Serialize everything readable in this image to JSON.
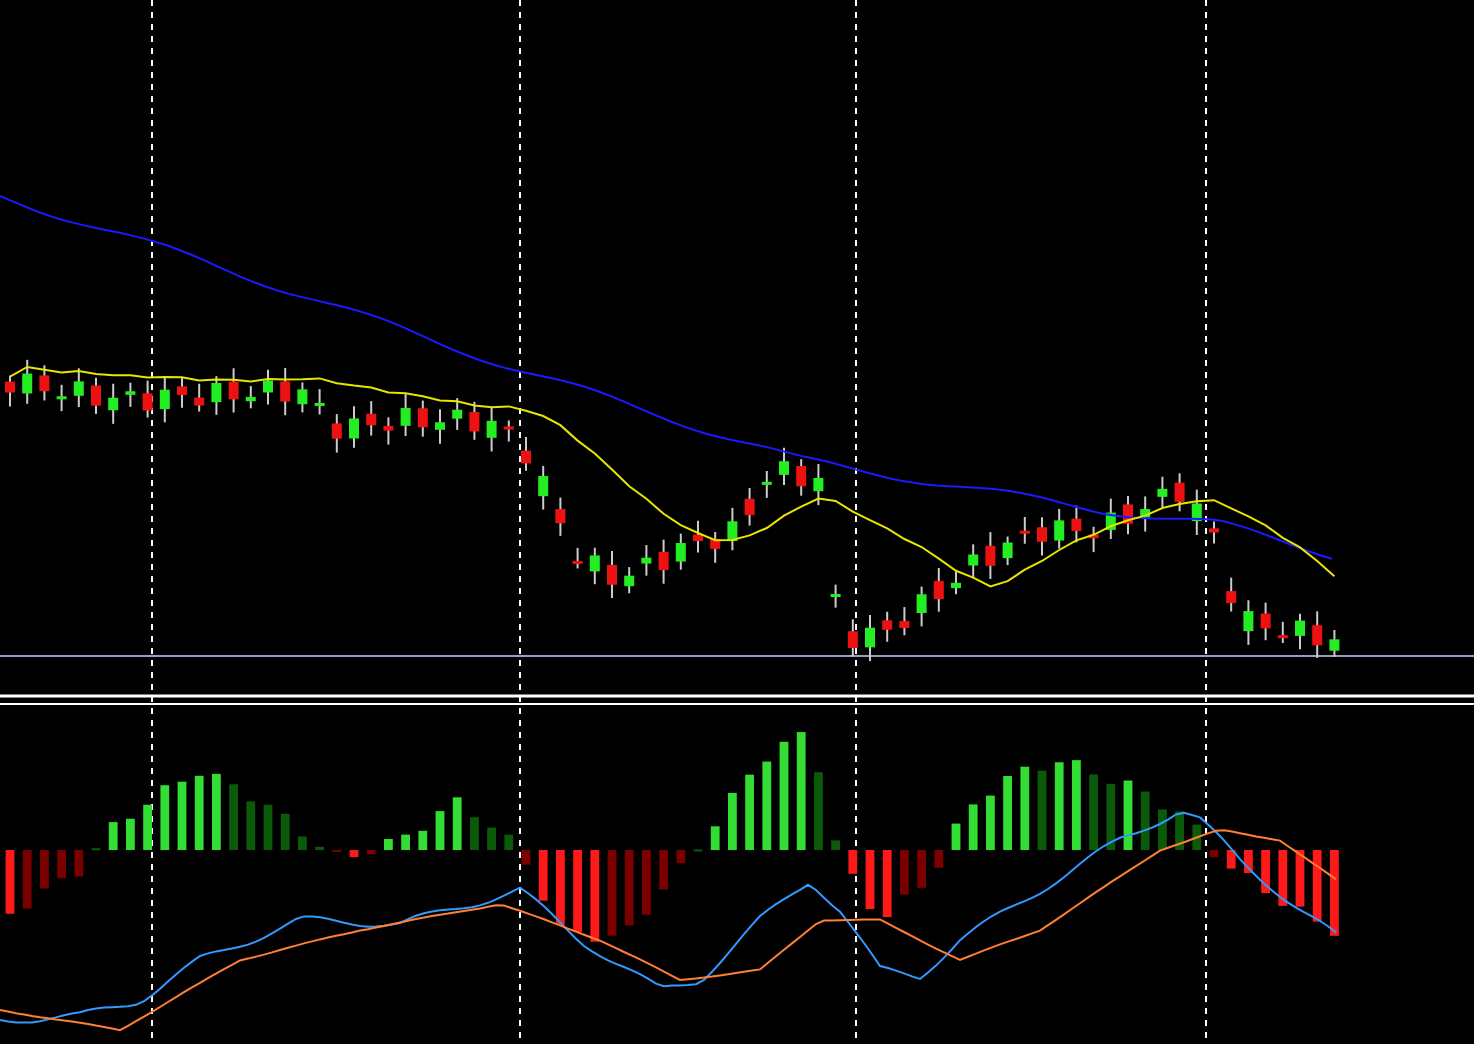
{
  "price_panel": {
    "lines": [
      {
        "color": "#1a1aff"
      },
      {
        "color": "#e6e600"
      }
    ]
  },
  "oscillator_panel": {
    "lines": [
      {
        "color": "#3399ff"
      },
      {
        "color": "#ff8033"
      }
    ]
  }
}
